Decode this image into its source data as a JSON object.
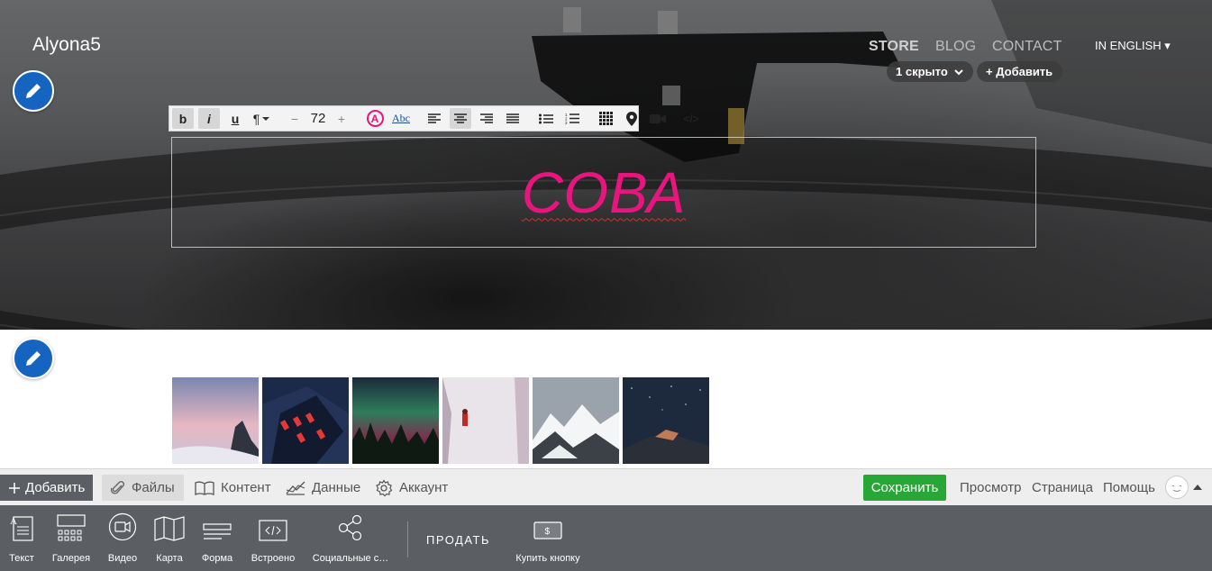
{
  "site": {
    "brand": "Alyona5",
    "nav": [
      {
        "label": "STORE",
        "active": true
      },
      {
        "label": "BLOG",
        "active": false
      },
      {
        "label": "CONTACT",
        "active": false
      }
    ],
    "language": "IN ENGLISH ▾",
    "hidden_pill": "1 скрыто",
    "add_pill": "+ Добавить"
  },
  "editor": {
    "font_size": "72",
    "font_size_minus": "−",
    "font_size_plus": "+",
    "heading_text": "СОВА",
    "heading_color": "#e8157e",
    "buttons": {
      "bold": "b",
      "italic": "i",
      "underline": "u",
      "paragraph": "¶",
      "color": "A",
      "spell": "Abc",
      "code": "</>"
    }
  },
  "toolbar": {
    "add": "Добавить",
    "files": "Файлы",
    "content": "Контент",
    "data": "Данные",
    "account": "Аккаунт",
    "save": "Сохранить",
    "preview": "Просмотр",
    "page": "Страница",
    "help": "Помощь",
    "save_color": "#27a836"
  },
  "insert_panel": {
    "items": [
      {
        "label": "Текст",
        "icon": "text-icon"
      },
      {
        "label": "Галерея",
        "icon": "gallery-icon"
      },
      {
        "label": "Видео",
        "icon": "video-icon"
      },
      {
        "label": "Карта",
        "icon": "map-icon"
      },
      {
        "label": "Форма",
        "icon": "form-icon"
      },
      {
        "label": "Встроено",
        "icon": "embed-icon"
      },
      {
        "label": "Социальные с…",
        "icon": "share-icon"
      }
    ],
    "sell": "ПРОДАТЬ",
    "buy_button": "Купить кнопку"
  }
}
